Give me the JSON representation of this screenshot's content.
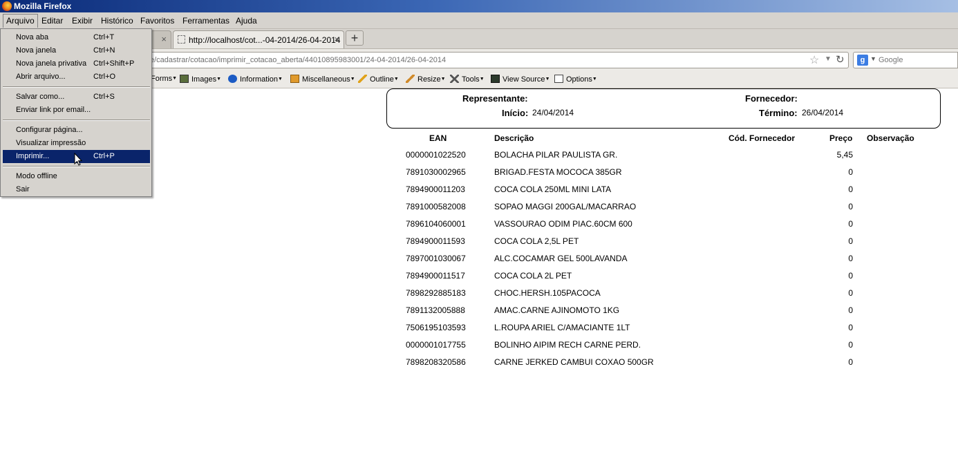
{
  "window": {
    "title": "Mozilla Firefox"
  },
  "menubar": {
    "items": [
      "Arquivo",
      "Editar",
      "Exibir",
      "Histórico",
      "Favoritos",
      "Ferramentas",
      "Ajuda"
    ]
  },
  "tabs": [
    {
      "label": "",
      "close": "×"
    },
    {
      "label": "http://localhost/cot...-04-2014/26-04-2014",
      "close": "×"
    }
  ],
  "newtab_label": "+",
  "navbar": {
    "url": "e/cadastrar/cotacao/imprimir_cotacao_aberta/44010895983001/24-04-2014/26-04-2014",
    "search_placeholder": "Google",
    "search_engine_letter": "g"
  },
  "devtoolbar": {
    "items": [
      "Forms",
      "Images",
      "Information",
      "Miscellaneous",
      "Outline",
      "Resize",
      "Tools",
      "View Source",
      "Options"
    ]
  },
  "file_menu": {
    "items": [
      {
        "label": "Nova aba",
        "shortcut": "Ctrl+T"
      },
      {
        "label": "Nova janela",
        "shortcut": "Ctrl+N"
      },
      {
        "label": "Nova janela privativa",
        "shortcut": "Ctrl+Shift+P"
      },
      {
        "label": "Abrir arquivo...",
        "shortcut": "Ctrl+O"
      },
      {
        "label": "Salvar como...",
        "shortcut": "Ctrl+S"
      },
      {
        "label": "Enviar link por email...",
        "shortcut": ""
      },
      {
        "label": "Configurar página...",
        "shortcut": ""
      },
      {
        "label": "Visualizar impressão",
        "shortcut": ""
      },
      {
        "label": "Imprimir...",
        "shortcut": "Ctrl+P"
      },
      {
        "label": "Modo offline",
        "shortcut": ""
      },
      {
        "label": "Sair",
        "shortcut": ""
      }
    ],
    "highlighted": "Imprimir..."
  },
  "report": {
    "representante_label": "Representante:",
    "representante_value": "",
    "fornecedor_label": "Fornecedor:",
    "fornecedor_value": "",
    "inicio_label": "Início:",
    "inicio_value": "24/04/2014",
    "termino_label": "Término:",
    "termino_value": "26/04/2014",
    "columns": [
      "EAN",
      "Descrição",
      "Cód. Fornecedor",
      "Preço",
      "Observação"
    ],
    "rows": [
      {
        "ean": "0000001022520",
        "desc": "BOLACHA PILAR PAULISTA GR.",
        "cod": "",
        "price": "5,45",
        "obs": ""
      },
      {
        "ean": "7891030002965",
        "desc": "BRIGAD.FESTA MOCOCA 385GR",
        "cod": "",
        "price": "0",
        "obs": ""
      },
      {
        "ean": "7894900011203",
        "desc": "COCA COLA 250ML MINI LATA",
        "cod": "",
        "price": "0",
        "obs": ""
      },
      {
        "ean": "7891000582008",
        "desc": "SOPAO MAGGI 200GAL/MACARRAO",
        "cod": "",
        "price": "0",
        "obs": ""
      },
      {
        "ean": "7896104060001",
        "desc": "VASSOURAO ODIM PIAC.60CM 600",
        "cod": "",
        "price": "0",
        "obs": ""
      },
      {
        "ean": "7894900011593",
        "desc": "COCA COLA 2,5L PET",
        "cod": "",
        "price": "0",
        "obs": ""
      },
      {
        "ean": "7897001030067",
        "desc": "ALC.COCAMAR GEL 500LAVANDA",
        "cod": "",
        "price": "0",
        "obs": ""
      },
      {
        "ean": "7894900011517",
        "desc": "COCA COLA 2L PET",
        "cod": "",
        "price": "0",
        "obs": ""
      },
      {
        "ean": "7898292885183",
        "desc": "CHOC.HERSH.105PACOCA",
        "cod": "",
        "price": "0",
        "obs": ""
      },
      {
        "ean": "7891132005888",
        "desc": "AMAC.CARNE AJINOMOTO 1KG",
        "cod": "",
        "price": "0",
        "obs": ""
      },
      {
        "ean": "7506195103593",
        "desc": "L.ROUPA ARIEL C/AMACIANTE 1LT",
        "cod": "",
        "price": "0",
        "obs": ""
      },
      {
        "ean": "0000001017755",
        "desc": "BOLINHO AIPIM RECH CARNE PERD.",
        "cod": "",
        "price": "0",
        "obs": ""
      },
      {
        "ean": "7898208320586",
        "desc": "CARNE JERKED CAMBUI COXAO 500GR",
        "cod": "",
        "price": "0",
        "obs": ""
      }
    ]
  },
  "colors": {
    "menu_highlight": "#0a246a",
    "chrome": "#d6d3ce",
    "titlebar_start": "#0a2a78"
  }
}
